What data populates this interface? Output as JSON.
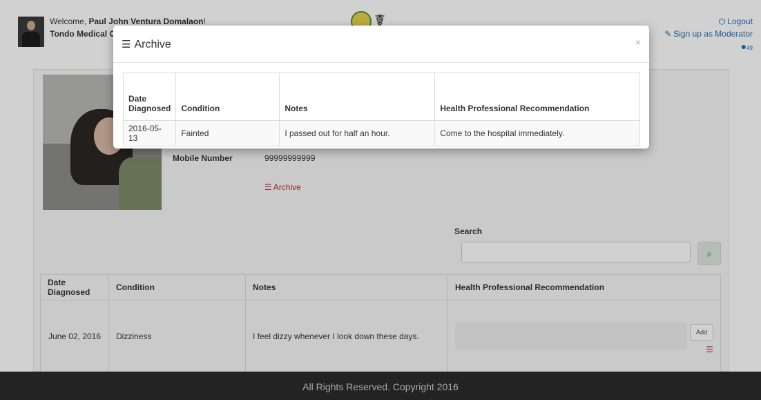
{
  "header": {
    "welcome_prefix": "Welcome, ",
    "user_name": "Paul John Ventura Domalaon",
    "welcome_suffix": "!",
    "hospital": "Tondo Medical Center",
    "logout_label": "Logout",
    "moderator_label": "Sign up as Moderator",
    "globe_count": "49"
  },
  "profile": {
    "mobile_label": "Mobile Number",
    "mobile_value": "99999999999",
    "archive_link_label": "Archive"
  },
  "search": {
    "label": "Search",
    "placeholder": ""
  },
  "records_table": {
    "headers": [
      "Date Diagnosed",
      "Condition",
      "Notes",
      "Health Professional Recommendation"
    ],
    "rows": [
      {
        "date": "June 02, 2016",
        "condition": "Dizziness",
        "notes": "I feel dizzy whenever I look down these days.",
        "add_label": "Add"
      }
    ]
  },
  "footer": {
    "text": "All Rights Reserved. Copyright 2016"
  },
  "modal": {
    "title": "Archive",
    "close_glyph": "×",
    "headers": [
      "Date Diagnosed",
      "Condition",
      "Notes",
      "Health Professional Recommendation"
    ],
    "rows": [
      {
        "date": "2016-05-13",
        "condition": "Fainted",
        "notes": "I passed out for half an hour.",
        "recommendation": "Come to the hospital immediately."
      }
    ]
  },
  "icons": {
    "logout": "power-icon",
    "moderator": "pencil-icon",
    "globe": "globe-icon",
    "archive": "archive-icon",
    "search": "search-icon",
    "delete": "archive-icon"
  },
  "colors": {
    "link_blue": "#2a6db0",
    "archive_red": "#b03030",
    "footer_bg": "#2b2b2b",
    "search_green": "#3c763d"
  }
}
